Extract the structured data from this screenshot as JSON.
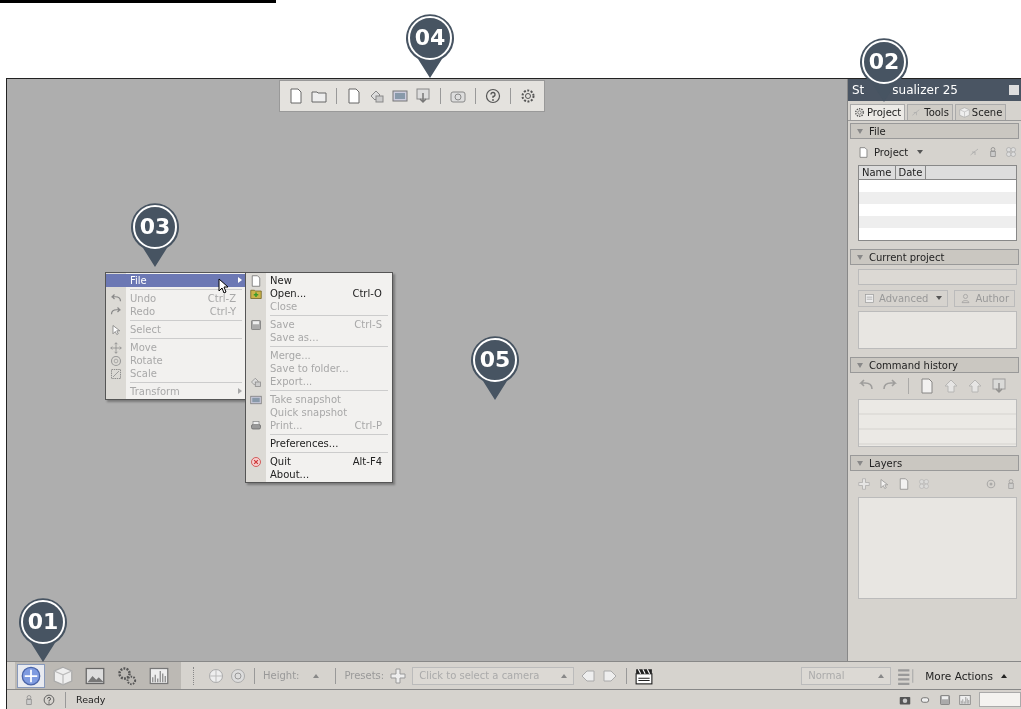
{
  "top_toolbar": {
    "callout": "04"
  },
  "viewport": {
    "callout": "05"
  },
  "context_menu": {
    "callout": "03",
    "items": [
      {
        "kind": "item",
        "label": "File",
        "selected": true,
        "disabled": false,
        "submenu": true
      },
      {
        "kind": "separator"
      },
      {
        "kind": "item",
        "label": "Undo",
        "shortcut": "Ctrl-Z",
        "selected": false,
        "disabled": true,
        "submenu": false
      },
      {
        "kind": "item",
        "label": "Redo",
        "shortcut": "Ctrl-Y",
        "selected": false,
        "disabled": true,
        "submenu": false
      },
      {
        "kind": "separator"
      },
      {
        "kind": "item",
        "label": "Select",
        "selected": false,
        "disabled": true,
        "submenu": false
      },
      {
        "kind": "separator"
      },
      {
        "kind": "item",
        "label": "Move",
        "selected": false,
        "disabled": true,
        "submenu": false
      },
      {
        "kind": "item",
        "label": "Rotate",
        "selected": false,
        "disabled": true,
        "submenu": false
      },
      {
        "kind": "item",
        "label": "Scale",
        "selected": false,
        "disabled": true,
        "submenu": false
      },
      {
        "kind": "separator"
      },
      {
        "kind": "item",
        "label": "Transform",
        "selected": false,
        "disabled": true,
        "submenu": true
      }
    ]
  },
  "file_submenu": {
    "items": [
      {
        "kind": "item",
        "label": "New",
        "disabled": false
      },
      {
        "kind": "item",
        "label": "Open...",
        "shortcut": "Ctrl-O",
        "disabled": false
      },
      {
        "kind": "item",
        "label": "Close",
        "disabled": true
      },
      {
        "kind": "separator"
      },
      {
        "kind": "item",
        "label": "Save",
        "shortcut": "Ctrl-S",
        "disabled": true
      },
      {
        "kind": "item",
        "label": "Save as...",
        "disabled": true
      },
      {
        "kind": "separator"
      },
      {
        "kind": "item",
        "label": "Merge...",
        "disabled": true
      },
      {
        "kind": "item",
        "label": "Save to folder...",
        "disabled": true
      },
      {
        "kind": "item",
        "label": "Export...",
        "disabled": true
      },
      {
        "kind": "separator"
      },
      {
        "kind": "item",
        "label": "Take snapshot",
        "disabled": true
      },
      {
        "kind": "item",
        "label": "Quick snapshot",
        "disabled": true
      },
      {
        "kind": "item",
        "label": "Print...",
        "shortcut": "Ctrl-P",
        "disabled": true
      },
      {
        "kind": "separator"
      },
      {
        "kind": "item",
        "label": "Preferences...",
        "disabled": false
      },
      {
        "kind": "separator"
      },
      {
        "kind": "item",
        "label": "Quit",
        "shortcut": "Alt-F4",
        "disabled": false
      },
      {
        "kind": "item",
        "label": "About...",
        "disabled": false
      }
    ]
  },
  "side_panel": {
    "callout": "02",
    "title_start": "St",
    "title_end": "sualizer 25",
    "tabs": [
      {
        "label": "Project",
        "selected": true
      },
      {
        "label": "Tools",
        "selected": false
      },
      {
        "label": "Scene",
        "selected": false
      }
    ],
    "file_section": {
      "title": "File",
      "dropdown": "Project",
      "columns": [
        "Name",
        "Date"
      ]
    },
    "current_project": {
      "title": "Current project",
      "dropdown": "Advanced",
      "button": "Author"
    },
    "command_history": {
      "title": "Command history"
    },
    "layers": {
      "title": "Layers"
    }
  },
  "bottom_toolbar": {
    "callout": "01",
    "modes": [
      {
        "selected": true
      },
      {
        "selected": false
      },
      {
        "selected": false
      },
      {
        "selected": false
      },
      {
        "selected": false
      }
    ],
    "height_label": "Height:",
    "presets_label": "Presets:",
    "camera_placeholder": "Click to select a camera",
    "view_mode": "Normal",
    "more_actions": "More Actions"
  },
  "status_bar": {
    "message": "Ready"
  }
}
